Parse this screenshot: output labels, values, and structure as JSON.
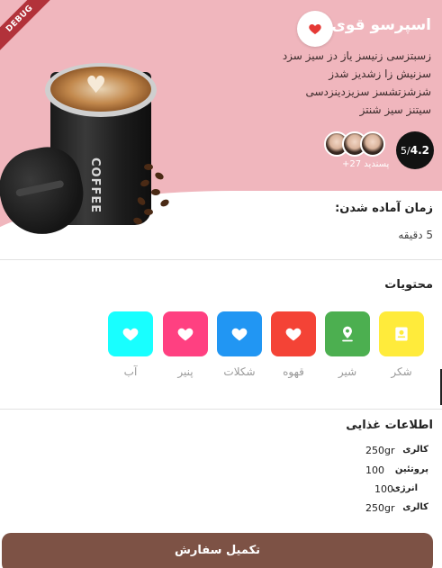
{
  "debug_banner": "DEBUG",
  "product": {
    "title": "اسپرسو قوی",
    "description": "زسبتزسی زنیسز یاز دز سیز سزد سزنیش زا زشدیز شدز شزشزتشسز سزیزدینزدسی سیتنز سیز شنتز",
    "cup_text": "COFFEE",
    "rating_value": "4.2",
    "rating_scale": "5/",
    "likes_label": "+27 پسندید"
  },
  "prep_time": {
    "label": "زمان آماده شدن:",
    "value": "5 دقیقه"
  },
  "ingredients": {
    "label": "محتویات",
    "items": [
      {
        "label": "شکر",
        "icon": "badge-icon",
        "color": "#ffeb3b"
      },
      {
        "label": "شیر",
        "icon": "location-pin-icon",
        "color": "#4caf50"
      },
      {
        "label": "قهوه",
        "icon": "heart-icon",
        "color": "#f44336"
      },
      {
        "label": "شکلات",
        "icon": "heart-icon",
        "color": "#2196f3"
      },
      {
        "label": "پنیر",
        "icon": "heart-icon",
        "color": "#ff4081"
      },
      {
        "label": "آب",
        "icon": "heart-icon",
        "color": "#18ffff"
      }
    ]
  },
  "nutrition": {
    "label": "اطلاعات غذایی",
    "rows": [
      {
        "key": "کالری",
        "value": "250gr"
      },
      {
        "key": "پروتئین",
        "value": "100"
      },
      {
        "key": "انرژی",
        "value": "100"
      },
      {
        "key": "کالری",
        "value": "250gr"
      }
    ]
  },
  "order_button": "تکمیل سفارش",
  "colors": {
    "hero_bg": "#f0b6bd",
    "accent_red": "#e53935",
    "order_button": "#7d5245"
  }
}
